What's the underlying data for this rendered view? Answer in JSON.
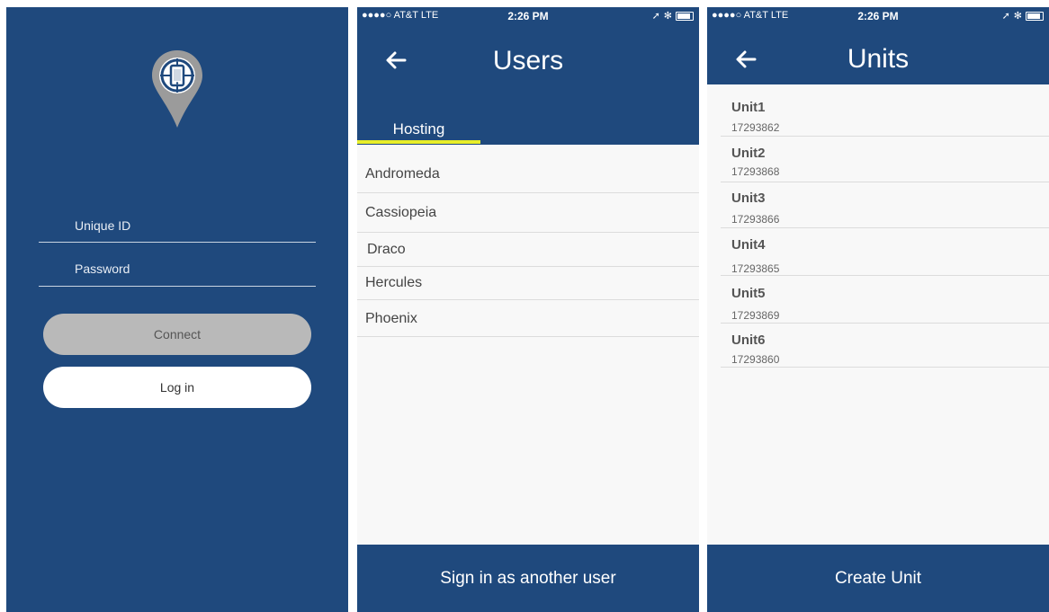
{
  "login": {
    "unique_id_label": "Unique ID",
    "password_label": "Password",
    "connect_label": "Connect",
    "login_label": "Log in"
  },
  "status_bar": {
    "carrier": "●●●●○ AT&T  LTE",
    "time": "2:26 PM"
  },
  "users_screen": {
    "title": "Users",
    "tab": "Hosting",
    "items": [
      "Andromeda",
      "Cassiopeia",
      "Draco",
      "Hercules",
      "Phoenix"
    ],
    "footer": "Sign in as another user"
  },
  "units_screen": {
    "title": "Units",
    "units": [
      {
        "name": "Unit1",
        "id": "17293862"
      },
      {
        "name": "Unit2",
        "id": "17293868"
      },
      {
        "name": "Unit3",
        "id": "17293866"
      },
      {
        "name": "Unit4",
        "id": "17293865"
      },
      {
        "name": "Unit5",
        "id": "17293869"
      },
      {
        "name": "Unit6",
        "id": "17293860"
      }
    ],
    "footer": "Create Unit"
  },
  "colors": {
    "brand_blue": "#1f497d",
    "tab_accent": "#e8ee2a",
    "connect_gray": "#b9b9b9"
  }
}
